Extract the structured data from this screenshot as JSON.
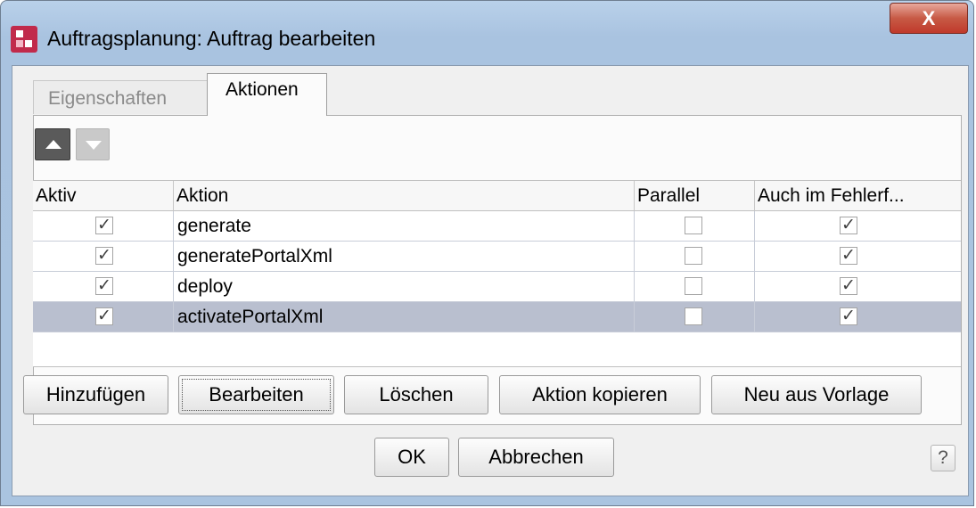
{
  "window": {
    "title": "Auftragsplanung: Auftrag bearbeiten",
    "close_label": "X"
  },
  "tabs": [
    {
      "label": "Eigenschaften",
      "active": false
    },
    {
      "label": "Aktionen",
      "active": true
    }
  ],
  "toolbar": {
    "move_up_icon": "arrow-up-icon",
    "move_down_icon": "arrow-down-icon"
  },
  "table": {
    "columns": [
      "Aktiv",
      "Aktion",
      "Parallel",
      "Auch im Fehlerf..."
    ],
    "rows": [
      {
        "aktiv": true,
        "aktion": "generate",
        "parallel": false,
        "fehler": true,
        "selected": false
      },
      {
        "aktiv": true,
        "aktion": "generatePortalXml",
        "parallel": false,
        "fehler": true,
        "selected": false
      },
      {
        "aktiv": true,
        "aktion": "deploy",
        "parallel": false,
        "fehler": true,
        "selected": false
      },
      {
        "aktiv": true,
        "aktion": "activatePortalXml",
        "parallel": false,
        "fehler": true,
        "selected": true
      }
    ]
  },
  "actions": {
    "add": "Hinzufügen",
    "edit": "Bearbeiten",
    "delete": "Löschen",
    "copy": "Aktion kopieren",
    "from_template": "Neu aus Vorlage"
  },
  "footer": {
    "ok": "OK",
    "cancel": "Abbrechen",
    "help": "?"
  },
  "colors": {
    "selection": "#b9bfcf",
    "close_button": "#c75a45",
    "app_icon": "#c12a4b"
  }
}
